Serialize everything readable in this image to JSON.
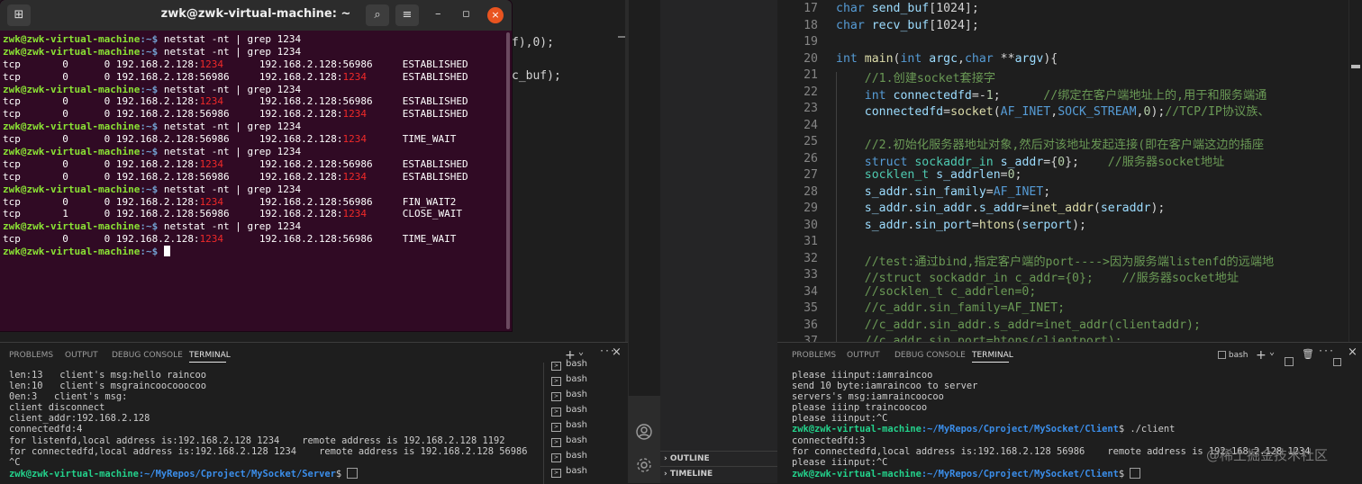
{
  "left_editor_fragments": [
    "f),0);",
    "c_buf);"
  ],
  "terminal": {
    "title": "zwk@zwk-virtual-machine: ~",
    "icons": {
      "new_tab": "new-tab-icon",
      "search": "search-icon",
      "menu": "hamburger-menu-icon",
      "minimize": "minimize-icon",
      "maximize": "maximize-icon",
      "close": "close-icon"
    },
    "prompt_user": "zwk@zwk-virtual-machine",
    "prompt_path": ":~$",
    "command": " netstat -nt | grep 1234",
    "lines": [
      {
        "type": "cmd"
      },
      {
        "type": "cmd"
      },
      {
        "type": "row",
        "proto": "tcp",
        "recv": "0",
        "send": "0",
        "local": "192.168.2.128:",
        "local_port": "1234",
        "local_red": true,
        "foreign": "192.168.2.128:56986",
        "foreign_port": "",
        "foreign_red": false,
        "state": "ESTABLISHED"
      },
      {
        "type": "row",
        "proto": "tcp",
        "recv": "0",
        "send": "0",
        "local": "192.168.2.128:56986",
        "local_port": "",
        "local_red": false,
        "foreign": "192.168.2.128:",
        "foreign_port": "1234",
        "foreign_red": true,
        "state": "ESTABLISHED"
      },
      {
        "type": "cmd"
      },
      {
        "type": "row",
        "proto": "tcp",
        "recv": "0",
        "send": "0",
        "local": "192.168.2.128:",
        "local_port": "1234",
        "local_red": true,
        "foreign": "192.168.2.128:56986",
        "foreign_port": "",
        "foreign_red": false,
        "state": "ESTABLISHED"
      },
      {
        "type": "row",
        "proto": "tcp",
        "recv": "0",
        "send": "0",
        "local": "192.168.2.128:56986",
        "local_port": "",
        "local_red": false,
        "foreign": "192.168.2.128:",
        "foreign_port": "1234",
        "foreign_red": true,
        "state": "ESTABLISHED"
      },
      {
        "type": "cmd"
      },
      {
        "type": "row",
        "proto": "tcp",
        "recv": "0",
        "send": "0",
        "local": "192.168.2.128:56986",
        "local_port": "",
        "local_red": false,
        "foreign": "192.168.2.128:",
        "foreign_port": "1234",
        "foreign_red": true,
        "state": "TIME_WAIT"
      },
      {
        "type": "cmd"
      },
      {
        "type": "row",
        "proto": "tcp",
        "recv": "0",
        "send": "0",
        "local": "192.168.2.128:",
        "local_port": "1234",
        "local_red": true,
        "foreign": "192.168.2.128:56986",
        "foreign_port": "",
        "foreign_red": false,
        "state": "ESTABLISHED"
      },
      {
        "type": "row",
        "proto": "tcp",
        "recv": "0",
        "send": "0",
        "local": "192.168.2.128:56986",
        "local_port": "",
        "local_red": false,
        "foreign": "192.168.2.128:",
        "foreign_port": "1234",
        "foreign_red": true,
        "state": "ESTABLISHED"
      },
      {
        "type": "cmd"
      },
      {
        "type": "row",
        "proto": "tcp",
        "recv": "0",
        "send": "0",
        "local": "192.168.2.128:",
        "local_port": "1234",
        "local_red": true,
        "foreign": "192.168.2.128:56986",
        "foreign_port": "",
        "foreign_red": false,
        "state": "FIN_WAIT2"
      },
      {
        "type": "row",
        "proto": "tcp",
        "recv": "1",
        "send": "0",
        "local": "192.168.2.128:56986",
        "local_port": "",
        "local_red": false,
        "foreign": "192.168.2.128:",
        "foreign_port": "1234",
        "foreign_red": true,
        "state": "CLOSE_WAIT"
      },
      {
        "type": "cmd"
      },
      {
        "type": "row",
        "proto": "tcp",
        "recv": "0",
        "send": "0",
        "local": "192.168.2.128:",
        "local_port": "1234",
        "local_red": true,
        "foreign": "192.168.2.128:56986",
        "foreign_port": "",
        "foreign_red": false,
        "state": "TIME_WAIT"
      },
      {
        "type": "prompt"
      }
    ]
  },
  "left_panel": {
    "tabs": [
      "PROBLEMS",
      "OUTPUT",
      "DEBUG CONSOLE",
      "TERMINAL"
    ],
    "active_tab": "TERMINAL",
    "add_label": "+",
    "chevron": "⌄",
    "close_glyph": "×",
    "output": [
      "len:13   client's msg:hello raincoo",
      "len:10   client's msgraincoocooocoo",
      "0en:3   client's msg:",
      "client disconnect",
      "client_addr:192.168.2.128",
      "connectedfd:4",
      "for listenfd,local address is:192.168.2.128 1234    remote address is 192.168.2.128 1192",
      "for connectedfd,local address is:192.168.2.128 1234    remote address is 192.168.2.128 56986",
      "^C"
    ],
    "prompt_user": "zwk@zwk-virtual-machine",
    "prompt_path": ":~/MyRepos/Cproject/MySocket/Server",
    "prompt_suffix": "$ ",
    "sessions": [
      "bash",
      "bash",
      "bash",
      "bash",
      "bash",
      "bash",
      "bash",
      "bash"
    ]
  },
  "sidebar": {
    "sections": [
      "OUTLINE",
      "TIMELINE"
    ],
    "icons": {
      "account": "account-icon",
      "settings": "gear-icon"
    }
  },
  "editor": {
    "lines": [
      {
        "n": "17",
        "tokens": [
          [
            "kw",
            "char "
          ],
          [
            "vr",
            "send_buf"
          ],
          [
            "",
            "[1024];"
          ]
        ]
      },
      {
        "n": "18",
        "tokens": [
          [
            "kw",
            "char "
          ],
          [
            "vr",
            "recv_buf"
          ],
          [
            "",
            "[1024];"
          ]
        ]
      },
      {
        "n": "19",
        "tokens": []
      },
      {
        "n": "20",
        "tokens": [
          [
            "kw",
            "int "
          ],
          [
            "fn",
            "main"
          ],
          [
            "",
            "("
          ],
          [
            "kw",
            "int "
          ],
          [
            "vr",
            "argc"
          ],
          [
            "",
            ","
          ],
          [
            "kw",
            "char "
          ],
          [
            "",
            "**"
          ],
          [
            "vr",
            "argv"
          ],
          [
            "",
            "){"
          ]
        ]
      },
      {
        "n": "21",
        "tokens": [
          [
            "cm",
            "    //1.创建socket套接字"
          ]
        ]
      },
      {
        "n": "22",
        "tokens": [
          [
            "",
            "    "
          ],
          [
            "kw",
            "int "
          ],
          [
            "vr",
            "connectedfd"
          ],
          [
            "",
            "=-"
          ],
          [
            "nm",
            "1"
          ],
          [
            "",
            ";"
          ],
          [
            "cm",
            "      //绑定在客户端地址上的,用于和服务端通"
          ]
        ]
      },
      {
        "n": "23",
        "tokens": [
          [
            "",
            "    "
          ],
          [
            "vr",
            "connectedfd"
          ],
          [
            "",
            "="
          ],
          [
            "fn",
            "socket"
          ],
          [
            "",
            "("
          ],
          [
            "mc",
            "AF_INET"
          ],
          [
            "",
            ","
          ],
          [
            "mc",
            "SOCK_STREAM"
          ],
          [
            "",
            ","
          ],
          [
            "nm",
            "0"
          ],
          [
            "",
            ");"
          ],
          [
            "cm",
            "//TCP/IP协议族、"
          ]
        ]
      },
      {
        "n": "24",
        "tokens": []
      },
      {
        "n": "25",
        "tokens": [
          [
            "cm",
            "    //2.初始化服务器地址对象,然后对该地址发起连接(即在客户端这边的插座"
          ]
        ]
      },
      {
        "n": "26",
        "tokens": [
          [
            "",
            "    "
          ],
          [
            "kw",
            "struct "
          ],
          [
            "ty",
            "sockaddr_in "
          ],
          [
            "vr",
            "s_addr"
          ],
          [
            "",
            "={"
          ],
          [
            "nm",
            "0"
          ],
          [
            "",
            "};"
          ],
          [
            "cm",
            "    //服务器socket地址"
          ]
        ]
      },
      {
        "n": "27",
        "tokens": [
          [
            "",
            "    "
          ],
          [
            "ty",
            "socklen_t "
          ],
          [
            "vr",
            "s_addrlen"
          ],
          [
            "",
            "="
          ],
          [
            "nm",
            "0"
          ],
          [
            "",
            ";"
          ]
        ]
      },
      {
        "n": "28",
        "tokens": [
          [
            "",
            "    "
          ],
          [
            "vr",
            "s_addr"
          ],
          [
            "",
            "."
          ],
          [
            "vr",
            "sin_family"
          ],
          [
            "",
            "="
          ],
          [
            "mc",
            "AF_INET"
          ],
          [
            "",
            ";"
          ]
        ]
      },
      {
        "n": "29",
        "tokens": [
          [
            "",
            "    "
          ],
          [
            "vr",
            "s_addr"
          ],
          [
            "",
            "."
          ],
          [
            "vr",
            "sin_addr"
          ],
          [
            "",
            "."
          ],
          [
            "vr",
            "s_addr"
          ],
          [
            "",
            "="
          ],
          [
            "fn",
            "inet_addr"
          ],
          [
            "",
            "("
          ],
          [
            "vr",
            "seraddr"
          ],
          [
            "",
            ");"
          ]
        ]
      },
      {
        "n": "30",
        "tokens": [
          [
            "",
            "    "
          ],
          [
            "vr",
            "s_addr"
          ],
          [
            "",
            "."
          ],
          [
            "vr",
            "sin_port"
          ],
          [
            "",
            "="
          ],
          [
            "fn",
            "htons"
          ],
          [
            "",
            "("
          ],
          [
            "vr",
            "serport"
          ],
          [
            "",
            ");"
          ]
        ]
      },
      {
        "n": "31",
        "tokens": []
      },
      {
        "n": "32",
        "tokens": [
          [
            "cm",
            "    //test:通过bind,指定客户端的port---->因为服务端listenfd的远端地"
          ]
        ]
      },
      {
        "n": "33",
        "tokens": [
          [
            "cm",
            "    //struct sockaddr_in c_addr={0};    //服务器socket地址"
          ]
        ]
      },
      {
        "n": "34",
        "tokens": [
          [
            "cm",
            "    //socklen_t c_addrlen=0;"
          ]
        ]
      },
      {
        "n": "35",
        "tokens": [
          [
            "cm",
            "    //c_addr.sin_family=AF_INET;"
          ]
        ]
      },
      {
        "n": "36",
        "tokens": [
          [
            "cm",
            "    //c_addr.sin_addr.s_addr=inet_addr(clientaddr);"
          ]
        ]
      },
      {
        "n": "37",
        "tokens": [
          [
            "cm",
            "    //c_addr.sin_port=htons(clientport);"
          ]
        ]
      }
    ]
  },
  "right_panel": {
    "tabs": [
      "PROBLEMS",
      "OUTPUT",
      "DEBUG CONSOLE",
      "TERMINAL"
    ],
    "active_tab": "TERMINAL",
    "shell": "bash",
    "add_label": "+",
    "chevron": "⌄",
    "close_glyph": "×",
    "output": [
      "please iiinput:iamraincoo",
      "send 10 byte:iamraincoo to server",
      "servers's msg:iamraincoocoo",
      "please iiinp traincoocoo",
      "please iiinput:^C"
    ],
    "prompt_user": "zwk@zwk-virtual-machine",
    "prompt_path": ":~/MyRepos/Cproject/MySocket/Client",
    "command": "$ ./client",
    "output2": [
      "connectedfd:3",
      "for connectedfd,local address is:192.168.2.128 56986    remote address is 192.168.2.128 1234",
      "please iiinput:^C"
    ],
    "prompt_suffix": "$ "
  },
  "watermark": "@稀土掘金技术社区"
}
